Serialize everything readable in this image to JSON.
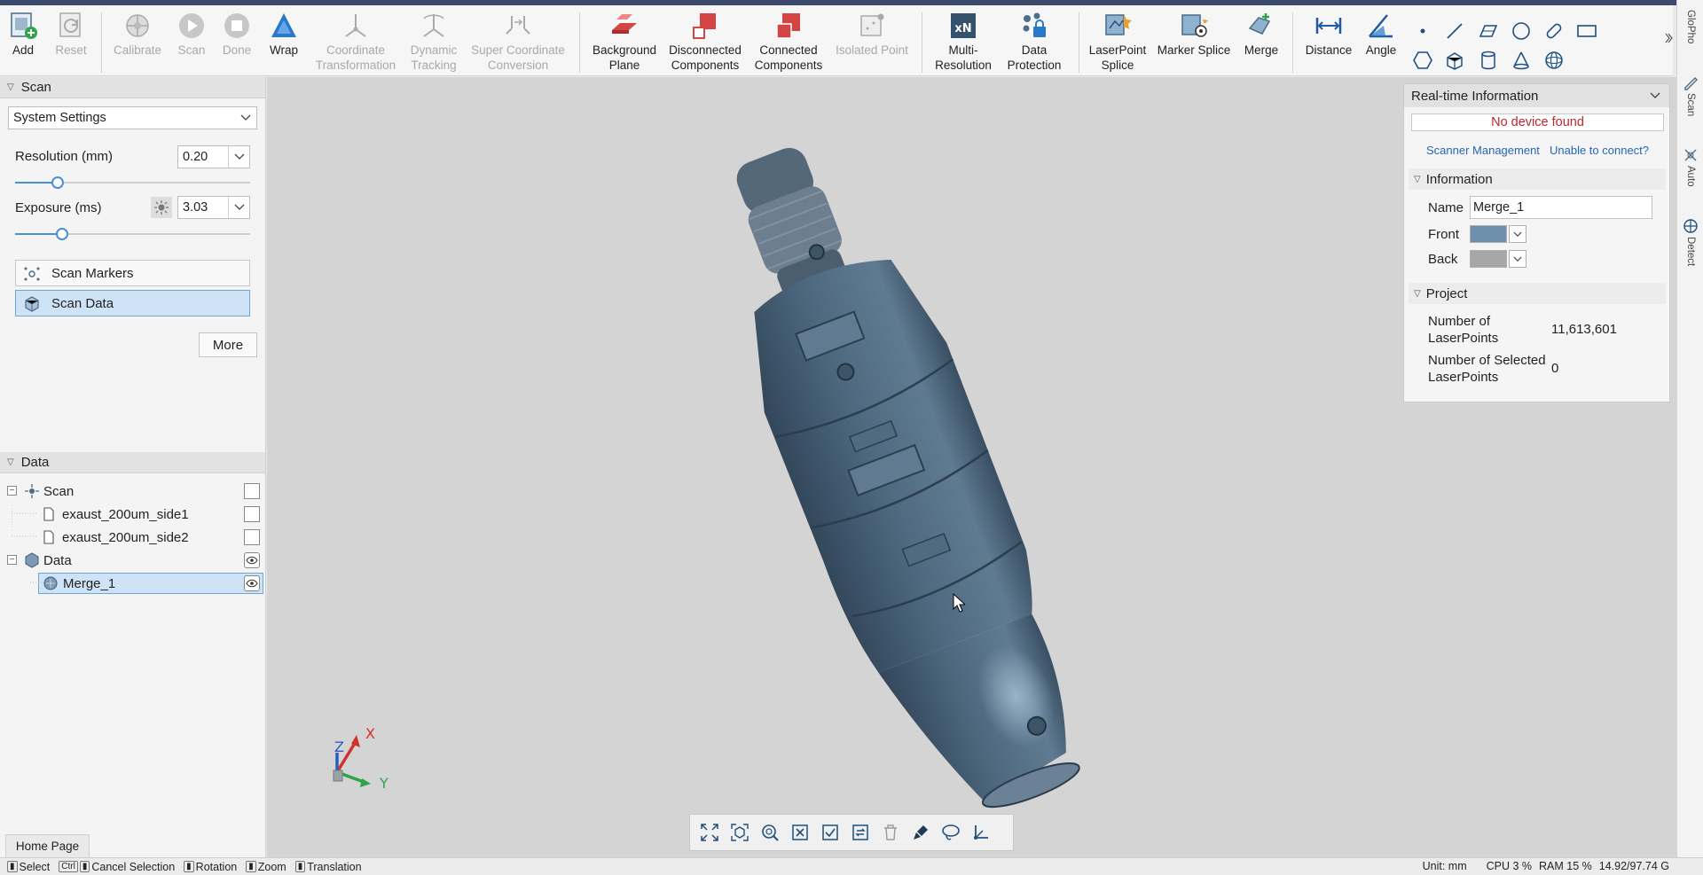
{
  "toolbar": {
    "groups": [
      {
        "items": [
          {
            "key": "add",
            "label": "Add",
            "icon": "add-icon",
            "enabled": true
          },
          {
            "key": "reset",
            "label": "Reset",
            "icon": "reset-icon",
            "enabled": false
          }
        ]
      },
      {
        "items": [
          {
            "key": "calibrate",
            "label": "Calibrate",
            "icon": "calibrate-icon",
            "enabled": false
          },
          {
            "key": "scan",
            "label": "Scan",
            "icon": "play-icon",
            "enabled": false
          },
          {
            "key": "done",
            "label": "Done",
            "icon": "stop-icon",
            "enabled": false
          },
          {
            "key": "wrap",
            "label": "Wrap",
            "icon": "triangle-icon",
            "enabled": true
          },
          {
            "key": "coordinate_transformation",
            "label": "Coordinate Transformation",
            "icon": "axes-icon",
            "enabled": false
          },
          {
            "key": "dynamic_tracking",
            "label": "Dynamic Tracking",
            "icon": "tracking-icon",
            "enabled": false
          },
          {
            "key": "super_coordinate_conversion",
            "label": "Super Coordinate Conversion",
            "icon": "conversion-icon",
            "enabled": false
          }
        ]
      },
      {
        "items": [
          {
            "key": "background_plane",
            "label": "Background Plane",
            "icon": "plane-icon",
            "enabled": true
          },
          {
            "key": "disconnected_components",
            "label": "Disconnected Components",
            "icon": "disconnected-icon",
            "enabled": true
          },
          {
            "key": "connected_components",
            "label": "Connected Components",
            "icon": "connected-icon",
            "enabled": true
          },
          {
            "key": "isolated_point",
            "label": "Isolated Point",
            "icon": "isolated-point-icon",
            "enabled": false
          }
        ]
      },
      {
        "items": [
          {
            "key": "multi_resolution",
            "label": "Multi-Resolution",
            "icon": "multi-resolution-icon",
            "enabled": true
          },
          {
            "key": "data_protection",
            "label": "Data Protection",
            "icon": "lock-icon",
            "enabled": true
          }
        ]
      },
      {
        "items": [
          {
            "key": "laserpoint_splice",
            "label": "LaserPoint Splice",
            "icon": "laser-splice-icon",
            "enabled": true
          },
          {
            "key": "marker_splice",
            "label": "Marker Splice",
            "icon": "marker-splice-icon",
            "enabled": true
          },
          {
            "key": "merge",
            "label": "Merge",
            "icon": "merge-icon",
            "enabled": true
          }
        ]
      },
      {
        "items": [
          {
            "key": "distance",
            "label": "Distance",
            "icon": "distance-icon",
            "enabled": true
          },
          {
            "key": "angle",
            "label": "Angle",
            "icon": "angle-icon",
            "enabled": true
          }
        ]
      }
    ],
    "mini_tools": [
      "point-icon",
      "line-icon",
      "plane-shape-icon",
      "circle-icon",
      "slot-icon",
      "rectangle-icon",
      "hexagon-icon",
      "cube-icon",
      "cylinder-icon",
      "cone-icon",
      "sphere-icon"
    ]
  },
  "right_strip": [
    {
      "label": "GloPho",
      "icon": "glopho-icon"
    },
    {
      "label": "Scan",
      "icon": "scan-pen-icon"
    },
    {
      "label": "Auto",
      "icon": "auto-icon"
    },
    {
      "label": "Detect",
      "icon": "detect-icon"
    }
  ],
  "scan_panel": {
    "title": "Scan",
    "settings_select": "System Settings",
    "resolution": {
      "label": "Resolution (mm)",
      "value": "0.20",
      "slider": 0.18
    },
    "exposure": {
      "label": "Exposure (ms)",
      "value": "3.03",
      "slider": 0.2
    },
    "buttons": [
      {
        "key": "scan_markers",
        "label": "Scan Markers",
        "selected": false
      },
      {
        "key": "scan_data",
        "label": "Scan Data",
        "selected": true
      }
    ],
    "more_label": "More"
  },
  "data_panel": {
    "title": "Data",
    "tree": [
      {
        "label": "Scan",
        "level": 0,
        "expander": "⊟",
        "icon": "scan-group-icon",
        "check": "box",
        "selected": false
      },
      {
        "label": "exaust_200um_side1",
        "level": 1,
        "icon": "file-icon",
        "check": "box",
        "selected": false
      },
      {
        "label": "exaust_200um_side2",
        "level": 1,
        "icon": "file-icon",
        "check": "box",
        "selected": false
      },
      {
        "label": "Data",
        "level": 0,
        "expander": "⊟",
        "icon": "data-group-icon",
        "check": "eye",
        "selected": false
      },
      {
        "label": "Merge_1",
        "level": 1,
        "icon": "mesh-icon",
        "check": "eye",
        "selected": true
      }
    ],
    "home_tab": "Home Page"
  },
  "info_panel": {
    "title": "Real-time Information",
    "status": "No device found",
    "links": [
      "Scanner Management",
      "Unable to connect?"
    ],
    "information": {
      "title": "Information",
      "name_label": "Name",
      "name_value": "Merge_1",
      "front_label": "Front",
      "front_color": "#6e8fae",
      "back_label": "Back",
      "back_color": "#a7a7a7"
    },
    "project": {
      "title": "Project",
      "laser_points_label": "Number of LaserPoints",
      "laser_points_value": "11,613,601",
      "selected_label": "Number of Selected LaserPoints",
      "selected_value": "0"
    }
  },
  "viewport": {
    "axes": {
      "x": "X",
      "y": "Y",
      "z": "Z"
    },
    "model_color": "#4c6478",
    "tools": [
      "fit-view-icon",
      "view-cube-icon",
      "zoom-icon",
      "deselect-icon",
      "select-all-icon",
      "invert-selection-icon",
      "delete-icon",
      "brush-select-icon",
      "lasso-select-icon",
      "coordinate-icon"
    ]
  },
  "status_bar": {
    "hints": [
      {
        "key": "",
        "text": "Select",
        "icon": "mouse-left-icon"
      },
      {
        "key": "Ctrl",
        "text": "Cancel Selection",
        "icon": "mouse-left-icon"
      },
      {
        "key": "",
        "text": "Rotation",
        "icon": "mouse-right-icon"
      },
      {
        "key": "",
        "text": "Zoom",
        "icon": "mouse-wheel-icon"
      },
      {
        "key": "",
        "text": "Translation",
        "icon": "mouse-middle-icon"
      }
    ],
    "unit": "Unit: mm",
    "cpu": "CPU 3 %",
    "ram": "RAM 15 %",
    "memory": "14.92/97.74 G"
  },
  "colors": {
    "accent": "#4a90d9",
    "selection": "#cfe3f7",
    "error": "#c0262d",
    "link": "#2466b8"
  }
}
